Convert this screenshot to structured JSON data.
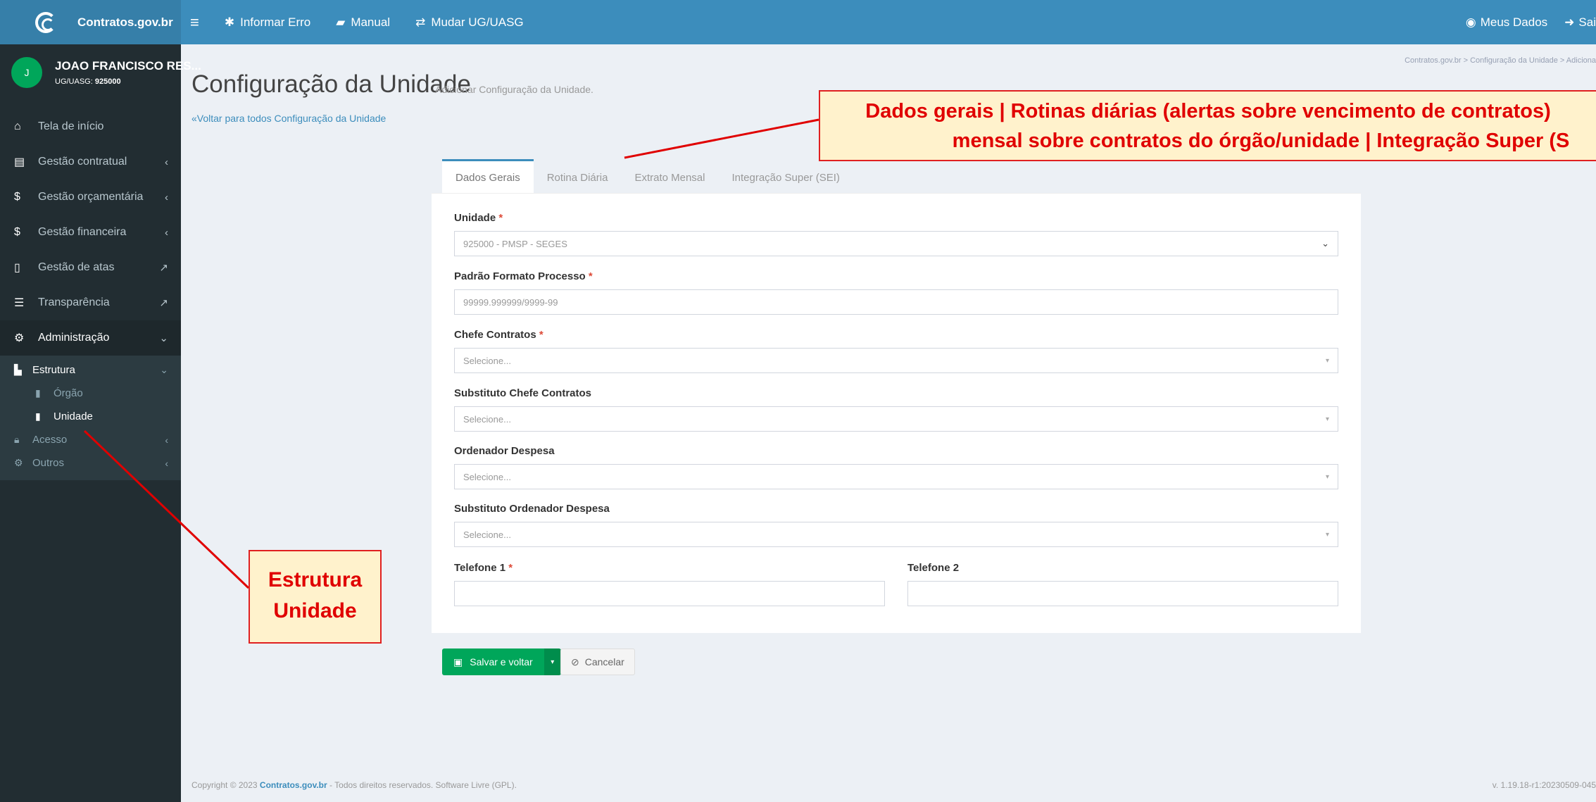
{
  "brand": {
    "name": "Contratos.gov.br"
  },
  "topnav": {
    "report_error": "Informar Erro",
    "manual": "Manual",
    "change_ug": "Mudar UG/UASG",
    "my_data": "Meus Dados",
    "logout": "Sai"
  },
  "user": {
    "initial": "J",
    "name": "JOAO FRANCISCO RES...",
    "ug_label": "UG/UASG:",
    "ug_value": "925000"
  },
  "sidebar": {
    "items": [
      {
        "label": "Tela de início",
        "icon": "home-icon"
      },
      {
        "label": "Gestão contratual",
        "icon": "document-icon"
      },
      {
        "label": "Gestão orçamentária",
        "icon": "dollar-icon"
      },
      {
        "label": "Gestão financeira",
        "icon": "dollar-icon"
      },
      {
        "label": "Gestão de atas",
        "icon": "file-icon"
      },
      {
        "label": "Transparência",
        "icon": "list-icon"
      },
      {
        "label": "Administração",
        "icon": "gears-icon"
      }
    ],
    "estrutura": "Estrutura",
    "orgao": "Órgão",
    "unidade": "Unidade",
    "acesso": "Acesso",
    "outros": "Outros"
  },
  "breadcrumb": "Contratos.gov.br  >  Configuração da Unidade  >  Adiciona",
  "page": {
    "title": "Configuração da Unidade",
    "subtitle": "Adicionar Configuração da Unidade.",
    "back_link": "Voltar para todos Configuração da Unidade"
  },
  "tabs": [
    "Dados Gerais",
    "Rotina Diária",
    "Extrato Mensal",
    "Integração Super (SEI)"
  ],
  "form": {
    "unidade_label": "Unidade",
    "unidade_value": "925000 - PMSP - SEGES",
    "padrao_label": "Padrão Formato Processo",
    "padrao_placeholder": "99999.999999/9999-99",
    "chefe_label": "Chefe Contratos",
    "chefe_value": "Selecione...",
    "sub_chefe_label": "Substituto Chefe Contratos",
    "sub_chefe_value": "Selecione...",
    "ordenador_label": "Ordenador Despesa",
    "ordenador_value": "Selecione...",
    "sub_ordenador_label": "Substituto Ordenador Despesa",
    "sub_ordenador_value": "Selecione...",
    "tel1_label": "Telefone 1",
    "tel2_label": "Telefone 2",
    "required_mark": "*"
  },
  "buttons": {
    "save": "Salvar e voltar",
    "cancel": "Cancelar"
  },
  "footer": {
    "prefix": "Copyright © 2023",
    "brand": "Contratos.gov.br",
    "suffix": "- Todos direitos reservados. Software Livre (GPL).",
    "version": "v. 1.19.18-r1:20230509-045"
  },
  "annotations": {
    "top_line1": "Dados gerais | Rotinas diárias (alertas sobre vencimento de contratos)",
    "top_line2": "mensal sobre contratos do órgão/unidade | Integração Super (S",
    "left_line1": "Estrutura",
    "left_line2": "Unidade"
  },
  "colors": {
    "topbar": "#3c8dbc",
    "sidebar": "#222d32",
    "success": "#00a65a",
    "annotation_border": "#e02020",
    "annotation_fill": "#fff2cc"
  }
}
